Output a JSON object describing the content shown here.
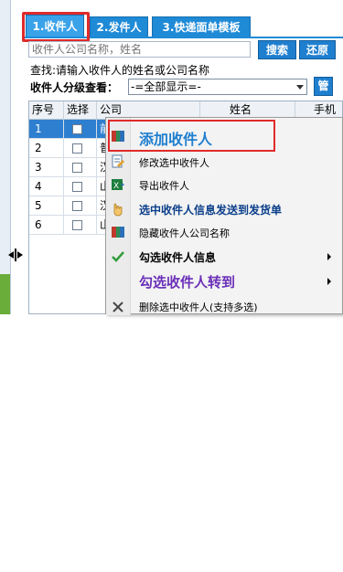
{
  "tabs": [
    {
      "label": "1.收件人",
      "active": true
    },
    {
      "label": "2.发件人",
      "active": false
    },
    {
      "label": "3.快递面单模板",
      "active": false
    }
  ],
  "search": {
    "placeholder": "收件人公司名称，姓名",
    "search_button": "搜索",
    "reset_button": "还原",
    "hint": "查找:请输入收件人的姓名或公司名称"
  },
  "filter": {
    "label": "收件人分级查看：",
    "selected": "-=全部显示=-",
    "menu_button": "管"
  },
  "grid": {
    "columns": [
      "序号",
      "选择",
      "公司",
      "姓名",
      "手机"
    ],
    "rows": [
      {
        "no": "1",
        "company": "前",
        "selected": true
      },
      {
        "no": "2",
        "company": "普",
        "selected": false
      },
      {
        "no": "3",
        "company": "汉",
        "selected": false
      },
      {
        "no": "4",
        "company": "山",
        "selected": false
      },
      {
        "no": "5",
        "company": "汉",
        "selected": false
      },
      {
        "no": "6",
        "company": "山",
        "selected": false
      }
    ]
  },
  "context_menu": {
    "items": [
      {
        "label": "添加收件人",
        "icon": "book-add-icon",
        "style": "big"
      },
      {
        "label": "修改选中收件人",
        "icon": "edit-doc-icon",
        "style": "normal"
      },
      {
        "label": "导出收件人",
        "icon": "excel-export-icon",
        "style": "normal"
      },
      {
        "label": "选中收件人信息发送到发货单",
        "icon": "hand-pointer-icon",
        "style": "boldblue"
      },
      {
        "label": "隐藏收件人公司名称",
        "icon": "book-hide-icon",
        "style": "normal"
      },
      {
        "label": "勾选收件人信息",
        "icon": "checkmark-icon",
        "style": "boldblack",
        "submenu": true
      },
      {
        "label": "勾选收件人转到",
        "icon": "",
        "style": "bigpurple",
        "submenu": true
      },
      {
        "label": "删除选中收件人(支持多选)",
        "icon": "delete-x-icon",
        "style": "normal"
      }
    ]
  },
  "colors": {
    "tab_blue": "#1f8ad6",
    "highlight_red": "#e02a2a",
    "selected_row": "#2e7fd0",
    "menu_blue_text": "#1f7fcf",
    "menu_purple_text": "#6a2fb8"
  }
}
